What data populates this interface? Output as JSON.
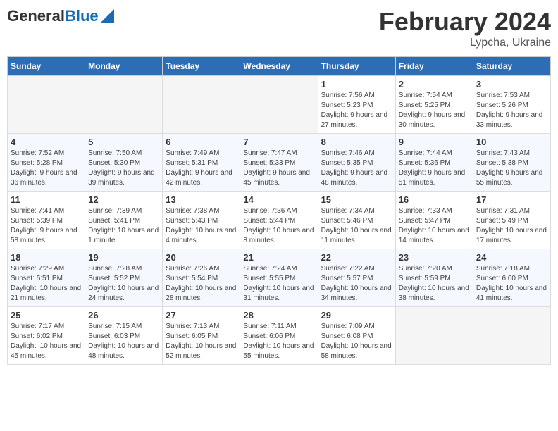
{
  "header": {
    "logo_general": "General",
    "logo_blue": "Blue",
    "title": "February 2024",
    "location": "Lypcha, Ukraine"
  },
  "days_of_week": [
    "Sunday",
    "Monday",
    "Tuesday",
    "Wednesday",
    "Thursday",
    "Friday",
    "Saturday"
  ],
  "weeks": [
    [
      {
        "day": "",
        "info": ""
      },
      {
        "day": "",
        "info": ""
      },
      {
        "day": "",
        "info": ""
      },
      {
        "day": "",
        "info": ""
      },
      {
        "day": "1",
        "info": "Sunrise: 7:56 AM\nSunset: 5:23 PM\nDaylight: 9 hours and 27 minutes."
      },
      {
        "day": "2",
        "info": "Sunrise: 7:54 AM\nSunset: 5:25 PM\nDaylight: 9 hours and 30 minutes."
      },
      {
        "day": "3",
        "info": "Sunrise: 7:53 AM\nSunset: 5:26 PM\nDaylight: 9 hours and 33 minutes."
      }
    ],
    [
      {
        "day": "4",
        "info": "Sunrise: 7:52 AM\nSunset: 5:28 PM\nDaylight: 9 hours and 36 minutes."
      },
      {
        "day": "5",
        "info": "Sunrise: 7:50 AM\nSunset: 5:30 PM\nDaylight: 9 hours and 39 minutes."
      },
      {
        "day": "6",
        "info": "Sunrise: 7:49 AM\nSunset: 5:31 PM\nDaylight: 9 hours and 42 minutes."
      },
      {
        "day": "7",
        "info": "Sunrise: 7:47 AM\nSunset: 5:33 PM\nDaylight: 9 hours and 45 minutes."
      },
      {
        "day": "8",
        "info": "Sunrise: 7:46 AM\nSunset: 5:35 PM\nDaylight: 9 hours and 48 minutes."
      },
      {
        "day": "9",
        "info": "Sunrise: 7:44 AM\nSunset: 5:36 PM\nDaylight: 9 hours and 51 minutes."
      },
      {
        "day": "10",
        "info": "Sunrise: 7:43 AM\nSunset: 5:38 PM\nDaylight: 9 hours and 55 minutes."
      }
    ],
    [
      {
        "day": "11",
        "info": "Sunrise: 7:41 AM\nSunset: 5:39 PM\nDaylight: 9 hours and 58 minutes."
      },
      {
        "day": "12",
        "info": "Sunrise: 7:39 AM\nSunset: 5:41 PM\nDaylight: 10 hours and 1 minute."
      },
      {
        "day": "13",
        "info": "Sunrise: 7:38 AM\nSunset: 5:43 PM\nDaylight: 10 hours and 4 minutes."
      },
      {
        "day": "14",
        "info": "Sunrise: 7:36 AM\nSunset: 5:44 PM\nDaylight: 10 hours and 8 minutes."
      },
      {
        "day": "15",
        "info": "Sunrise: 7:34 AM\nSunset: 5:46 PM\nDaylight: 10 hours and 11 minutes."
      },
      {
        "day": "16",
        "info": "Sunrise: 7:33 AM\nSunset: 5:47 PM\nDaylight: 10 hours and 14 minutes."
      },
      {
        "day": "17",
        "info": "Sunrise: 7:31 AM\nSunset: 5:49 PM\nDaylight: 10 hours and 17 minutes."
      }
    ],
    [
      {
        "day": "18",
        "info": "Sunrise: 7:29 AM\nSunset: 5:51 PM\nDaylight: 10 hours and 21 minutes."
      },
      {
        "day": "19",
        "info": "Sunrise: 7:28 AM\nSunset: 5:52 PM\nDaylight: 10 hours and 24 minutes."
      },
      {
        "day": "20",
        "info": "Sunrise: 7:26 AM\nSunset: 5:54 PM\nDaylight: 10 hours and 28 minutes."
      },
      {
        "day": "21",
        "info": "Sunrise: 7:24 AM\nSunset: 5:55 PM\nDaylight: 10 hours and 31 minutes."
      },
      {
        "day": "22",
        "info": "Sunrise: 7:22 AM\nSunset: 5:57 PM\nDaylight: 10 hours and 34 minutes."
      },
      {
        "day": "23",
        "info": "Sunrise: 7:20 AM\nSunset: 5:59 PM\nDaylight: 10 hours and 38 minutes."
      },
      {
        "day": "24",
        "info": "Sunrise: 7:18 AM\nSunset: 6:00 PM\nDaylight: 10 hours and 41 minutes."
      }
    ],
    [
      {
        "day": "25",
        "info": "Sunrise: 7:17 AM\nSunset: 6:02 PM\nDaylight: 10 hours and 45 minutes."
      },
      {
        "day": "26",
        "info": "Sunrise: 7:15 AM\nSunset: 6:03 PM\nDaylight: 10 hours and 48 minutes."
      },
      {
        "day": "27",
        "info": "Sunrise: 7:13 AM\nSunset: 6:05 PM\nDaylight: 10 hours and 52 minutes."
      },
      {
        "day": "28",
        "info": "Sunrise: 7:11 AM\nSunset: 6:06 PM\nDaylight: 10 hours and 55 minutes."
      },
      {
        "day": "29",
        "info": "Sunrise: 7:09 AM\nSunset: 6:08 PM\nDaylight: 10 hours and 58 minutes."
      },
      {
        "day": "",
        "info": ""
      },
      {
        "day": "",
        "info": ""
      }
    ]
  ]
}
